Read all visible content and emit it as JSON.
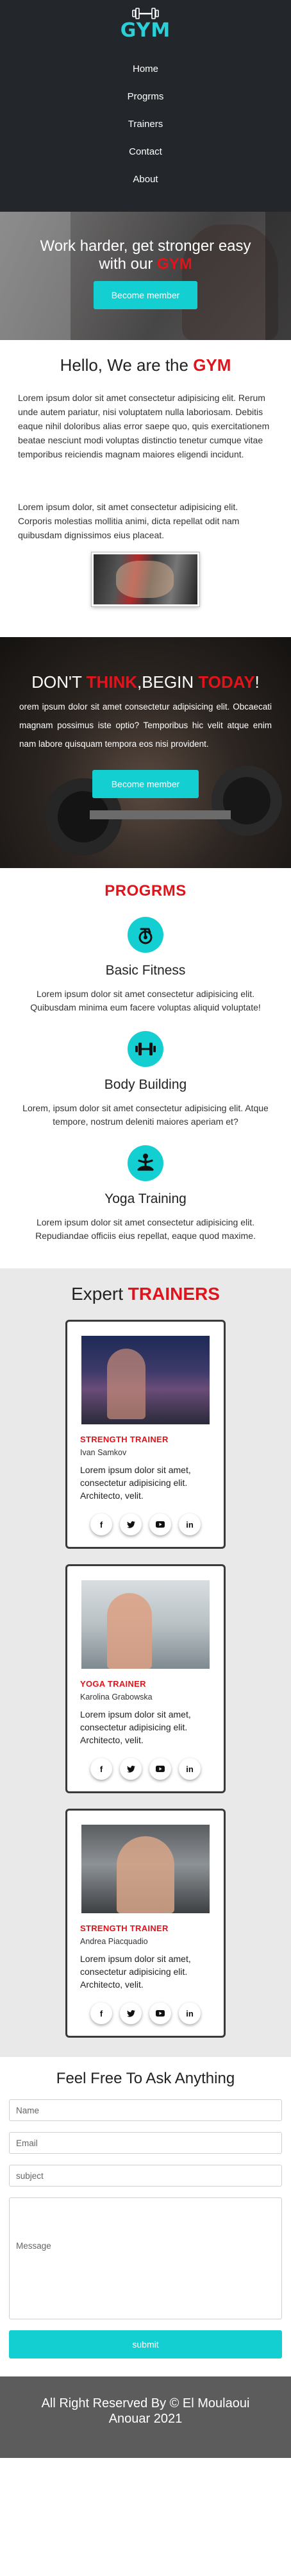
{
  "brand": {
    "logo_text": "GYM"
  },
  "nav": {
    "items": [
      "Home",
      "Progrms",
      "Trainers",
      "Contact",
      "About"
    ]
  },
  "hero": {
    "title_prefix": "Work harder, get stronger easy with our ",
    "title_highlight": "GYM",
    "button": "Become member"
  },
  "about": {
    "heading_prefix": "Hello, We are the ",
    "heading_highlight": "GYM",
    "paragraph1": "Lorem ipsum dolor sit amet consectetur adipisicing elit. Rerum unde autem pariatur, nisi voluptatem nulla laboriosam. Debitis eaque nihil doloribus alias error saepe quo, quis exercitationem beatae nesciunt modi voluptas distinctio tenetur cumque vitae temporibus reiciendis magnam maiores eligendi incidunt.",
    "paragraph2": "Lorem ipsum dolor, sit amet consectetur adipisicing elit. Corporis molestias mollitia animi, dicta repellat odit nam quibusdam dignissimos eius placeat."
  },
  "banner": {
    "title_a": "DON'T ",
    "title_b": "THINK",
    "title_c": ",BEGIN ",
    "title_d": "TODAY",
    "title_e": "!",
    "text": "orem ipsum dolor sit amet consectetur adipisicing elit. Obcaecati magnam possimus iste optio? Temporibus hic velit atque enim nam labore quisquam tempora eos nisi provident.",
    "button": "Become member"
  },
  "programs": {
    "title": "PROGRMS",
    "items": [
      {
        "icon": "bike-icon",
        "name": "Basic Fitness",
        "text": "Lorem ipsum dolor sit amet consectetur adipisicing elit. Quibusdam minima eum facere voluptas aliquid voluptate!"
      },
      {
        "icon": "dumbbell-icon",
        "name": "Body Building",
        "text": "Lorem, ipsum dolor sit amet consectetur adipisicing elit. Atque tempore, nostrum deleniti maiores aperiam et?"
      },
      {
        "icon": "yoga-icon",
        "name": "Yoga Training",
        "text": "Lorem ipsum dolor sit amet consectetur adipisicing elit. Repudiandae officiis eius repellat, eaque quod maxime."
      }
    ]
  },
  "trainers": {
    "title_prefix": "Expert ",
    "title_highlight": "TRAINERS",
    "cards": [
      {
        "role": "STRENGTH TRAINER",
        "name": "Ivan Samkov",
        "desc": "Lorem ipsum dolor sit amet, consectetur adipisicing elit. Architecto, velit."
      },
      {
        "role": "YOGA TRAINER",
        "name": "Karolina Grabowska",
        "desc": "Lorem ipsum dolor sit amet, consectetur adipisicing elit. Architecto, velit."
      },
      {
        "role": "STRENGTH TRAINER",
        "name": "Andrea Piacquadio",
        "desc": "Lorem ipsum dolor sit amet, consectetur adipisicing elit. Architecto, velit."
      }
    ],
    "socials": [
      "f",
      "t",
      "yt",
      "in"
    ]
  },
  "contact": {
    "title": "Feel Free To Ask Anything",
    "name_placeholder": "Name",
    "email_placeholder": "Email",
    "subject_placeholder": "subject",
    "message_placeholder": "Message",
    "submit": "submit"
  },
  "footer": {
    "text": "All Right Reserved By © El Moulaoui Anouar 2021"
  },
  "colors": {
    "accent": "#14cfd2",
    "highlight": "#e0141a",
    "nav_bg": "#23262b",
    "footer_bg": "#5c5c5c"
  }
}
